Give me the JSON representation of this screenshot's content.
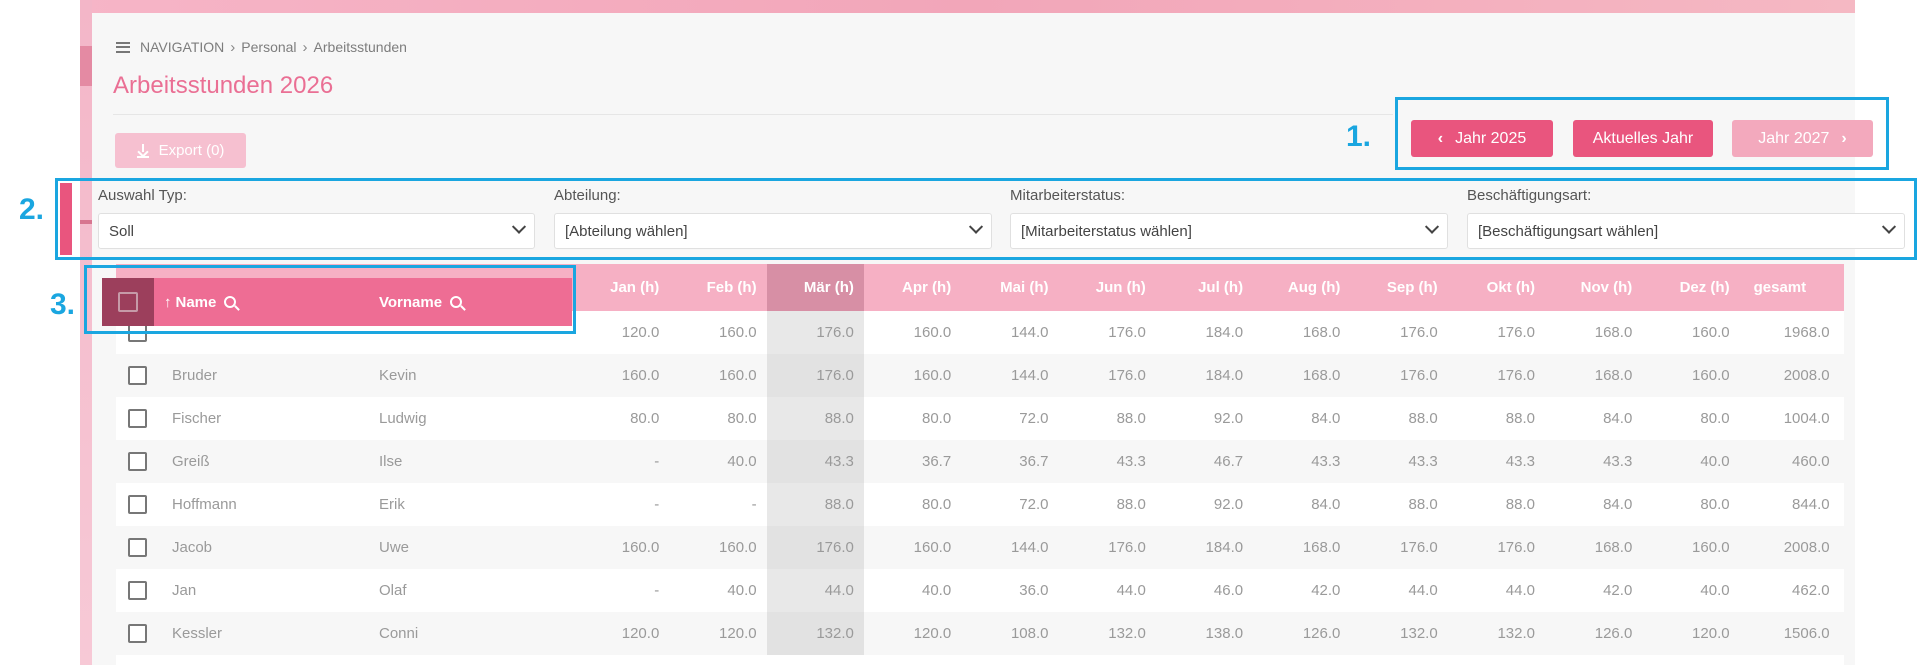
{
  "breadcrumb": {
    "root": "NAVIGATION",
    "items": [
      "Personal",
      "Arbeitsstunden"
    ]
  },
  "page": {
    "title": "Arbeitsstunden 2026"
  },
  "toolbar": {
    "export_label": "Export (0)"
  },
  "year_nav": {
    "prev_label": "Jahr 2025",
    "current_label": "Aktuelles Jahr",
    "next_label": "Jahr 2027"
  },
  "annotations": [
    "1.",
    "2.",
    "3."
  ],
  "filters": [
    {
      "label": "Auswahl Typ:",
      "value": "Soll"
    },
    {
      "label": "Abteilung:",
      "value": "[Abteilung wählen]"
    },
    {
      "label": "Mitarbeiterstatus:",
      "value": "[Mitarbeiterstatus wählen]"
    },
    {
      "label": "Beschäftigungsart:",
      "value": "[Beschäftigungsart wählen]"
    }
  ],
  "table": {
    "name_header": "Name",
    "vorname_header": "Vorname",
    "month_headers": [
      "Jan (h)",
      "Feb (h)",
      "Mär (h)",
      "Apr (h)",
      "Mai (h)",
      "Jun (h)",
      "Jul (h)",
      "Aug (h)",
      "Sep (h)",
      "Okt (h)",
      "Nov (h)",
      "Dez (h)"
    ],
    "total_header": "gesamt",
    "rows": [
      {
        "name": "",
        "vorname": "",
        "values": [
          "120.0",
          "160.0",
          "176.0",
          "160.0",
          "144.0",
          "176.0",
          "184.0",
          "168.0",
          "176.0",
          "176.0",
          "168.0",
          "160.0"
        ],
        "total": "1968.0"
      },
      {
        "name": "Bruder",
        "vorname": "Kevin",
        "values": [
          "160.0",
          "160.0",
          "176.0",
          "160.0",
          "144.0",
          "176.0",
          "184.0",
          "168.0",
          "176.0",
          "176.0",
          "168.0",
          "160.0"
        ],
        "total": "2008.0"
      },
      {
        "name": "Fischer",
        "vorname": "Ludwig",
        "values": [
          "80.0",
          "80.0",
          "88.0",
          "80.0",
          "72.0",
          "88.0",
          "92.0",
          "84.0",
          "88.0",
          "88.0",
          "84.0",
          "80.0"
        ],
        "total": "1004.0"
      },
      {
        "name": "Greiß",
        "vorname": "Ilse",
        "values": [
          "-",
          "40.0",
          "43.3",
          "36.7",
          "36.7",
          "43.3",
          "46.7",
          "43.3",
          "43.3",
          "43.3",
          "43.3",
          "40.0"
        ],
        "total": "460.0"
      },
      {
        "name": "Hoffmann",
        "vorname": "Erik",
        "values": [
          "-",
          "-",
          "88.0",
          "80.0",
          "72.0",
          "88.0",
          "92.0",
          "84.0",
          "88.0",
          "88.0",
          "84.0",
          "80.0"
        ],
        "total": "844.0"
      },
      {
        "name": "Jacob",
        "vorname": "Uwe",
        "values": [
          "160.0",
          "160.0",
          "176.0",
          "160.0",
          "144.0",
          "176.0",
          "184.0",
          "168.0",
          "176.0",
          "176.0",
          "168.0",
          "160.0"
        ],
        "total": "2008.0"
      },
      {
        "name": "Jan",
        "vorname": "Olaf",
        "values": [
          "-",
          "40.0",
          "44.0",
          "40.0",
          "36.0",
          "44.0",
          "46.0",
          "42.0",
          "44.0",
          "44.0",
          "42.0",
          "40.0"
        ],
        "total": "462.0"
      },
      {
        "name": "Kessler",
        "vorname": "Conni",
        "values": [
          "120.0",
          "120.0",
          "132.0",
          "120.0",
          "108.0",
          "132.0",
          "138.0",
          "126.0",
          "132.0",
          "132.0",
          "126.0",
          "120.0"
        ],
        "total": "1506.0"
      }
    ]
  }
}
